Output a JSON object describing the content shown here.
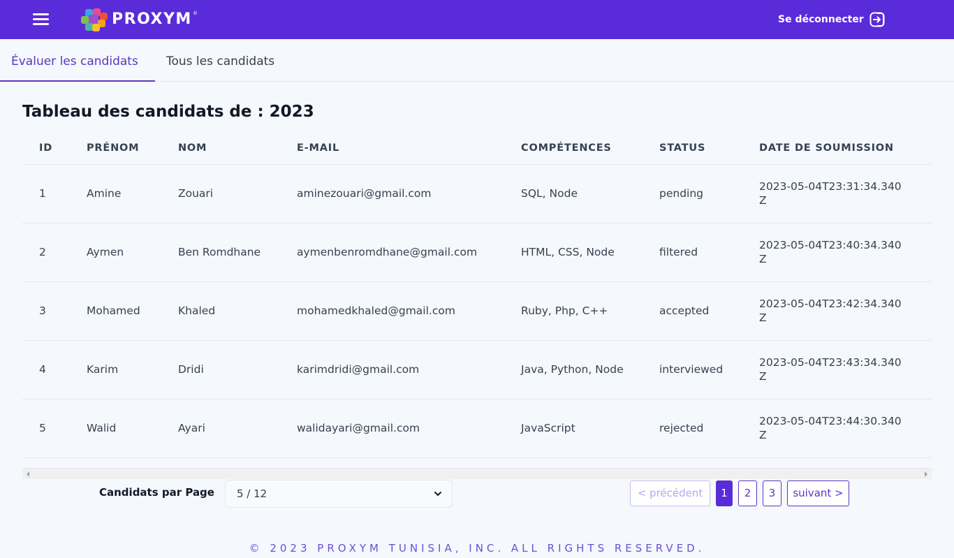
{
  "header": {
    "brand": "PROXYM",
    "brand_mark": "®",
    "logout_label": "Se déconnecter"
  },
  "tabs": [
    {
      "label": "Évaluer les candidats",
      "active": true
    },
    {
      "label": "Tous les candidats",
      "active": false
    }
  ],
  "page_title": "Tableau des candidats de : 2023",
  "table": {
    "columns": [
      "ID",
      "PRÉNOM",
      "NOM",
      "E-MAIL",
      "COMPÉTENCES",
      "STATUS",
      "DATE DE SOUMISSION"
    ],
    "rows": [
      [
        "1",
        "Amine",
        "Zouari",
        "aminezouari@gmail.com",
        "SQL, Node",
        "pending",
        "2023-05-04T23:31:34.340Z"
      ],
      [
        "2",
        "Aymen",
        "Ben Romdhane",
        "aymenbenromdhane@gmail.com",
        "HTML, CSS, Node",
        "filtered",
        "2023-05-04T23:40:34.340Z"
      ],
      [
        "3",
        "Mohamed",
        "Khaled",
        "mohamedkhaled@gmail.com",
        "Ruby, Php, C++",
        "accepted",
        "2023-05-04T23:42:34.340Z"
      ],
      [
        "4",
        "Karim",
        "Dridi",
        "karimdridi@gmail.com",
        "Java, Python, Node",
        "interviewed",
        "2023-05-04T23:43:34.340Z"
      ],
      [
        "5",
        "Walid",
        "Ayari",
        "walidayari@gmail.com",
        "JavaScript",
        "rejected",
        "2023-05-04T23:44:30.340Z"
      ]
    ]
  },
  "pagination": {
    "per_page_label": "Candidats par Page",
    "per_page_value": "5 / 12",
    "prev_label": "< précédent",
    "pages": [
      "1",
      "2",
      "3"
    ],
    "current_page": "1",
    "next_label": "suivant >"
  },
  "footer": "© 2023 PROXYM TUNISIA, INC. ALL RIGHTS RESERVED.",
  "colors": {
    "header_bg": "#5a2bd9",
    "accent": "#5b35c4",
    "page_bg": "#f5f8fc"
  }
}
